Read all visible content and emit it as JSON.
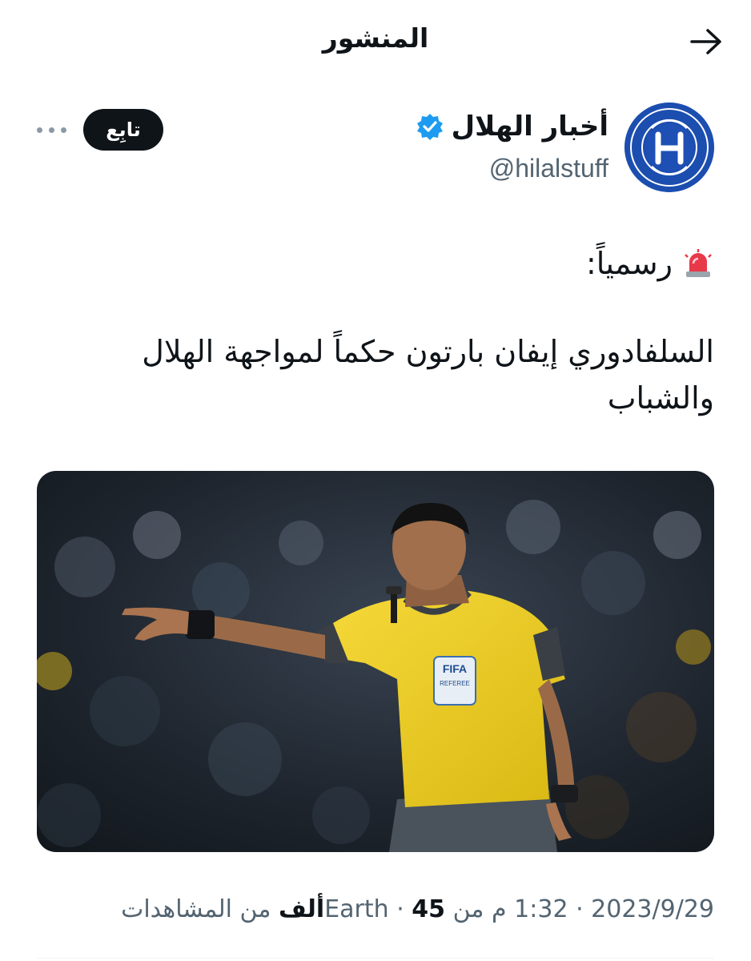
{
  "header": {
    "title": "المنشور",
    "back_icon": "arrow-right-icon"
  },
  "author": {
    "display_name": "أخبار الهلال",
    "handle": "@hilalstuff",
    "verified_icon": "verified-badge-icon",
    "avatar_text": "HILALSTUFF",
    "avatar_sub": "أخبار الهلال",
    "follow_label": "تابِع",
    "more_icon": "more-horizontal-icon"
  },
  "tweet": {
    "line1": "رسمياً:",
    "line1_icon": "police-light-emoji-icon",
    "line2": "السلفادوري إيفان بارتون حكماً لمواجهة الهلال والشباب"
  },
  "media": {
    "badge_text": "FIFA",
    "badge_sub": "REFEREE"
  },
  "meta": {
    "date": "2023/9/29",
    "time": "1:32 م",
    "source": "من Earth",
    "views_count": "45ألف",
    "views_label": "من المشاهدات"
  },
  "colors": {
    "text": "#0f1419",
    "secondary": "#536471",
    "verified": "#1d9bf0",
    "follow_bg": "#0f1419",
    "avatar_bg": "#1c4eb0",
    "jersey": "#f2d21e"
  }
}
